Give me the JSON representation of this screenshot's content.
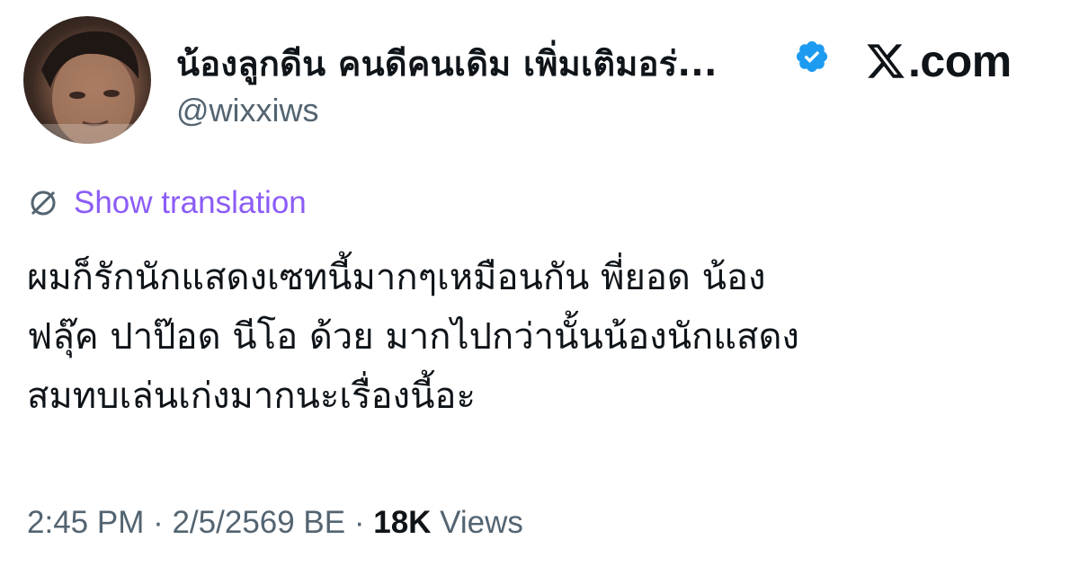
{
  "author": {
    "display_name": "น้องลูกดีน คนดีคนเดิม เพิ่มเติมอร่...",
    "handle": "@wixxiws",
    "verified": true,
    "verified_color": "#1d9bf0"
  },
  "brand": {
    "logo_icon": "x-logo-icon",
    "text": ".com"
  },
  "translation": {
    "icon": "globe-icon",
    "label": "Show translation",
    "color": "#8b5cf6"
  },
  "tweet": {
    "lines": [
      "ผมก็รักนักแสดงเซทนี้มากๆเหมือนกัน พี่ยอด น้อง",
      "ฟลุ๊ค ปาป๊อด นีโอ ด้วย  มากไปกว่านั้นน้องนักแสดง",
      "สมทบเล่นเก่งมากนะเรื่องนี้อะ"
    ]
  },
  "meta": {
    "time": "2:45 PM",
    "separator": " · ",
    "date": "2/5/2569 BE",
    "views_count": "18K",
    "views_label": " Views"
  },
  "colors": {
    "text_primary": "#0f1419",
    "text_secondary": "#536471"
  }
}
